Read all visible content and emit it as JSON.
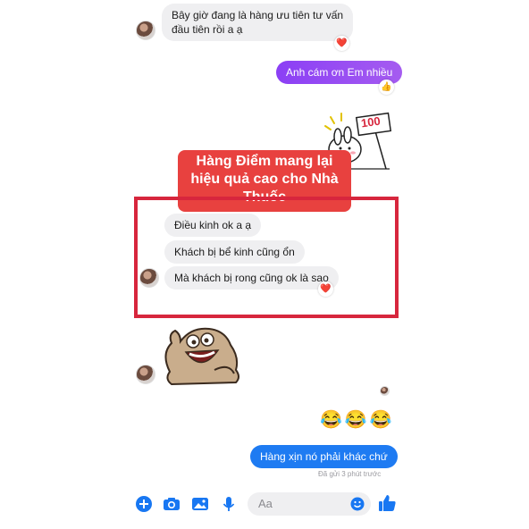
{
  "messages": {
    "m1_line1": "Bây giờ đang là hàng ưu tiên tư vấn",
    "m1_line2": "đầu tiên rồi a ạ",
    "m2": "Anh cám ơn Em nhiều",
    "m3": "Điều kinh ok a ạ",
    "m4": "Khách bị bể kinh cũng ổn",
    "m5": "Mà khách bị rong cũng ok là sao",
    "m6": "Hàng xịn nó phải khác chứ"
  },
  "reactions": {
    "heart": "❤️",
    "thumbs": "👍",
    "laugh": "😂😂😂"
  },
  "sticker_sign": "100",
  "banner": {
    "line1": "Hàng Điểm mang lại",
    "line2": "hiệu quả cao cho Nhà",
    "line3": "Thuốc"
  },
  "status": "Đã gửi 3 phút trước",
  "composer": {
    "placeholder": "Aa"
  },
  "colors": {
    "outgoing_purple": "#8b3ff5",
    "outgoing_blue": "#1e7bf2",
    "banner_red": "#e8413f",
    "frame_red": "#d7263d",
    "icon_blue": "#1877f2"
  },
  "icons": [
    "plus-circle-icon",
    "camera-icon",
    "image-icon",
    "mic-icon",
    "smiley-icon",
    "like-icon"
  ]
}
